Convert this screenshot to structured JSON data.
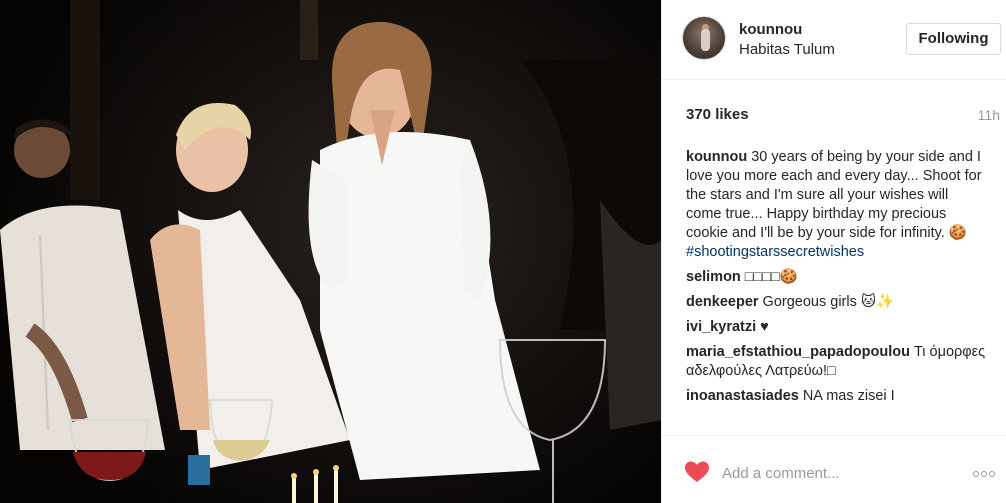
{
  "post": {
    "username": "kounnou",
    "location": "Habitas Tulum",
    "follow_label": "Following",
    "likes": "370 likes",
    "time": "11h"
  },
  "caption": {
    "user": "kounnou",
    "text": "30 years of being by your side and I love you more each and every day... Shoot for the stars and I'm sure all your wishes will come true... Happy birthday my precious cookie and I'll be by your side for infinity. 🍪",
    "hashtag": "#shootingstarssecretwishes"
  },
  "comments": [
    {
      "user": "selimon",
      "text": "□□□□🍪"
    },
    {
      "user": "denkeeper",
      "text": "Gorgeous girls 🐱✨"
    },
    {
      "user": "ivi_kyratzi",
      "text": "♥"
    },
    {
      "user": "maria_efstathiou_papadopoulou",
      "text": "Τι όμορφες αδελφούλες Λατρεύω!□"
    },
    {
      "user": "inoanastasiades",
      "text": "NA mas zisei I"
    }
  ],
  "footer": {
    "comment_placeholder": "Add a comment...",
    "heart_color": "#ed4956"
  },
  "icons": {
    "like": "heart-icon",
    "options": "more-options-icon"
  }
}
